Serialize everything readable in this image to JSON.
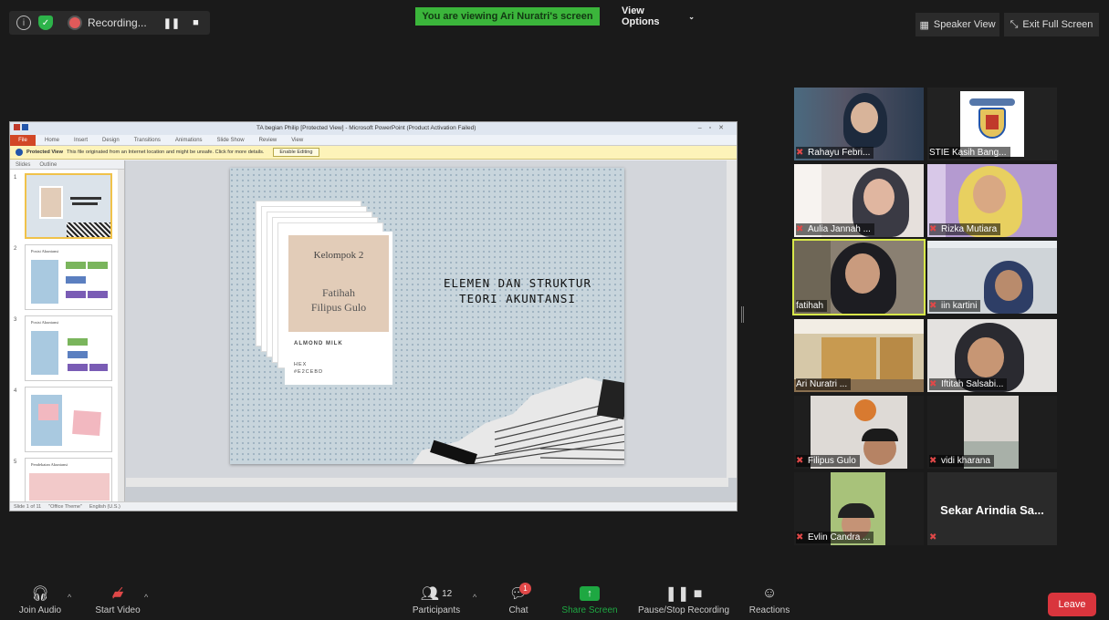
{
  "topbar": {
    "recording_label": "Recording...",
    "viewing_banner": "You are viewing Ari Nuratri's screen",
    "view_options": "View Options",
    "speaker_view": "Speaker View",
    "exit_fullscreen": "Exit Full Screen"
  },
  "ppt": {
    "window_title": "TA begian Philip [Protected View] - Microsoft PowerPoint (Product Activation Failed)",
    "file_tab": "File",
    "ribbon_tabs": [
      "Home",
      "Insert",
      "Design",
      "Transitions",
      "Animations",
      "Slide Show",
      "Review",
      "View"
    ],
    "protected_bold": "Protected View",
    "protected_msg": "This file originated from an Internet location and might be unsafe. Click for more details.",
    "enable_editing": "Enable Editing",
    "panel_tabs": [
      "Slides",
      "Outline"
    ],
    "thumbnails": [
      {
        "num": "1",
        "caption": ""
      },
      {
        "num": "2",
        "caption": "Posisi Akuntansi"
      },
      {
        "num": "3",
        "caption": "Posisi Akuntansi"
      },
      {
        "num": "4",
        "caption": ""
      },
      {
        "num": "5",
        "caption": "Pendekatan Akuntansi"
      }
    ],
    "slide": {
      "kelompok": "Kelompok 2",
      "name1": "Fatihah",
      "name2": "Filipus Gulo",
      "almond": "ALMOND MILK",
      "hex_label": "HEX",
      "hex_value": "#E2CEBD",
      "title_line1": "ELEMEN DAN STRUKTUR",
      "title_line2": "TEORI AKUNTANSI"
    },
    "status_left": "Slide 1 of 11",
    "status_theme": "\"Office Theme\"",
    "status_lang": "English (U.S.)"
  },
  "gallery": [
    {
      "name": "Rahayu Febri...",
      "muted": true
    },
    {
      "name": "STIE Kasih Bang...",
      "muted": false
    },
    {
      "name": "Aulia Jannah ...",
      "muted": true
    },
    {
      "name": "Rizka Mutiara",
      "muted": true
    },
    {
      "name": "fatihah",
      "muted": false
    },
    {
      "name": "iin kartini",
      "muted": true
    },
    {
      "name": "Ari Nuratri ...",
      "muted": false
    },
    {
      "name": "Iftitah Salsabi...",
      "muted": true
    },
    {
      "name": "Filipus Gulo",
      "muted": true
    },
    {
      "name": "vidi kharana",
      "muted": true
    },
    {
      "name": "Evlin Candra ...",
      "muted": true
    },
    {
      "name": "Sekar Arindia Sa...",
      "muted": true
    }
  ],
  "bottombar": {
    "join_audio": "Join Audio",
    "start_video": "Start Video",
    "participants": "Participants",
    "participants_count": "12",
    "chat": "Chat",
    "chat_badge": "1",
    "share_screen": "Share Screen",
    "pause_stop": "Pause/Stop Recording",
    "reactions": "Reactions",
    "leave": "Leave"
  },
  "colors": {
    "share_green": "#1ea842",
    "leave_red": "#d9353d",
    "active_speaker": "#d8e84a",
    "card_color": "#E2CEBD"
  }
}
